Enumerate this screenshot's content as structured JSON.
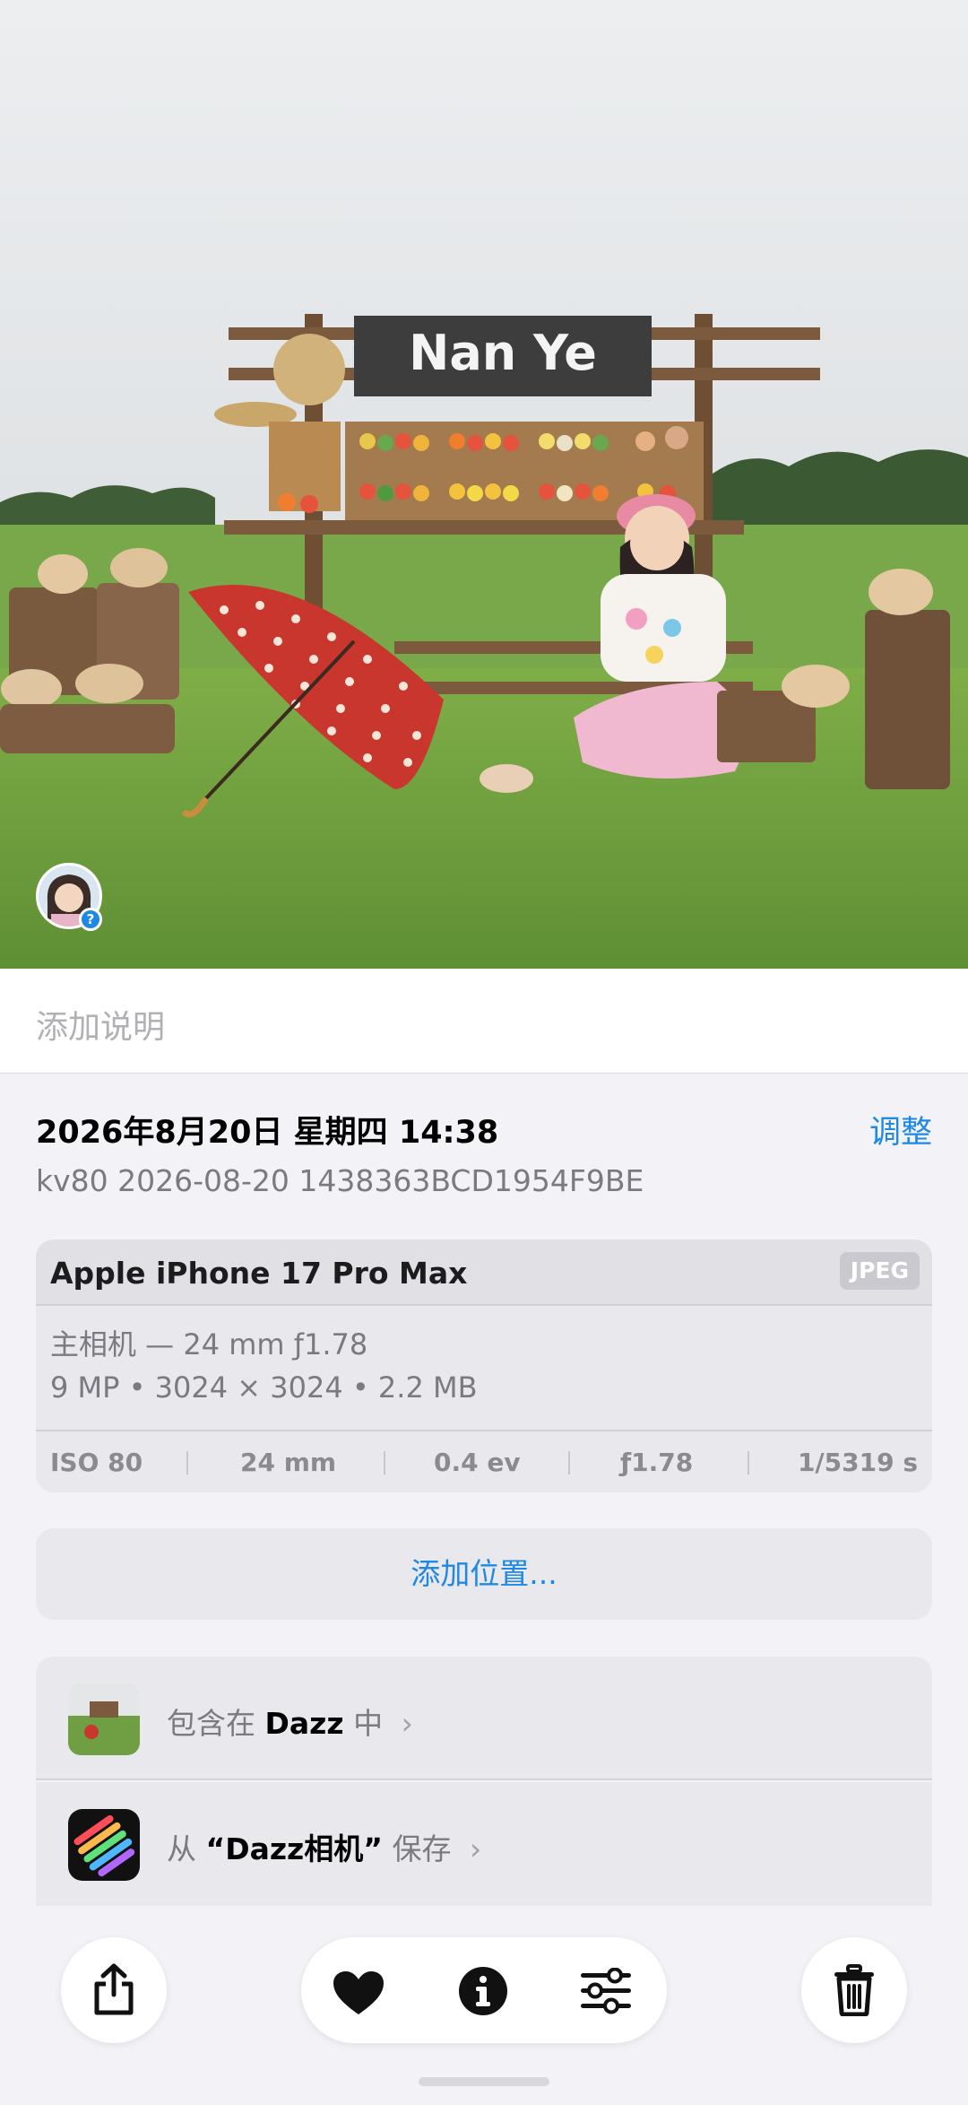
{
  "photo": {
    "sign_text": "Nan Ye",
    "description_icon": "photo-farm-stand"
  },
  "caption": {
    "placeholder": "添加说明"
  },
  "info": {
    "datetime": "2026年8月20日 星期四 14:38",
    "adjust_label": "调整",
    "filename": "kv80 2026-08-20 1438363BCD1954F9BE"
  },
  "camera_card": {
    "device": "Apple iPhone 17 Pro Max",
    "format": "JPEG",
    "lens": "主相机 — 24 mm ƒ1.78",
    "resolution": "9 MP • 3024 × 3024 • 2.2 MB",
    "exif": {
      "iso": "ISO 80",
      "focal": "24 mm",
      "ev": "0.4 ev",
      "aperture": "ƒ1.78",
      "shutter": "1/5319 s"
    }
  },
  "location": {
    "label": "添加位置..."
  },
  "sources": {
    "album": {
      "prefix": "包含在",
      "name": "Dazz",
      "suffix": "中"
    },
    "app": {
      "prefix": "从",
      "name": "“Dazz相机”",
      "suffix": "保存"
    }
  },
  "toolbar": {
    "icons": [
      "share-icon",
      "heart-icon",
      "info-icon",
      "adjust-icon",
      "trash-icon"
    ]
  }
}
